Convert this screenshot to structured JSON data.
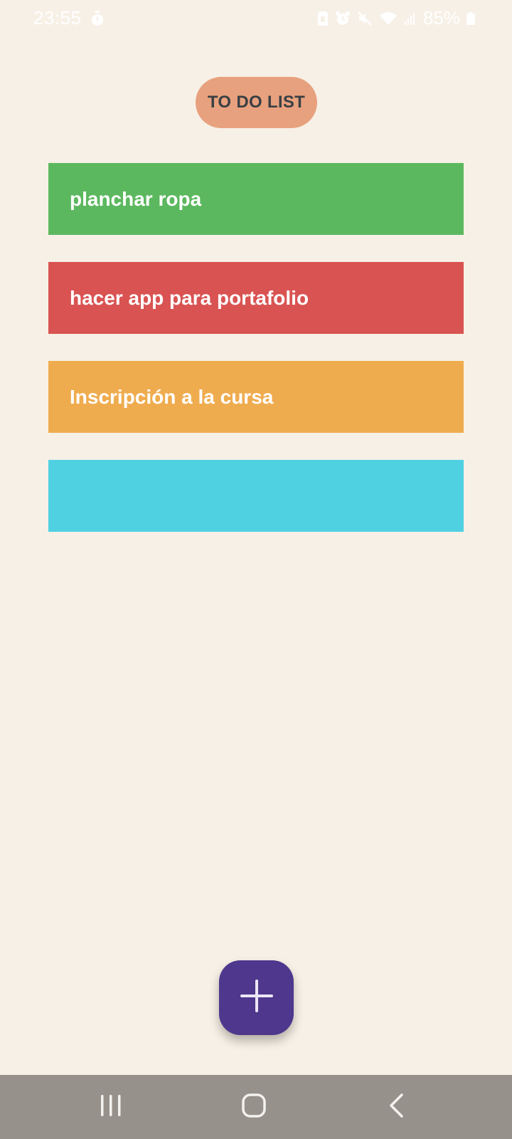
{
  "status_bar": {
    "time": "23:55",
    "battery_percent": "85%",
    "icons": [
      "timer-icon",
      "sim-icon",
      "alarm-icon",
      "mute-icon",
      "wifi-icon",
      "signal-icon",
      "battery-icon"
    ]
  },
  "header": {
    "title": "TO DO LIST",
    "color": "#e8a17e"
  },
  "tasks": [
    {
      "label": "planchar ropa",
      "color": "#5cb85f"
    },
    {
      "label": "hacer app para portafolio",
      "color": "#d95352"
    },
    {
      "label": "Inscripción a la cursa",
      "color": "#efac4f"
    },
    {
      "label": "",
      "color": "#4fd1e2"
    }
  ],
  "fab": {
    "icon": "plus-icon",
    "color": "#4e378c"
  },
  "nav_bar": {
    "icons": [
      "recent-apps-icon",
      "home-icon",
      "back-icon"
    ]
  }
}
